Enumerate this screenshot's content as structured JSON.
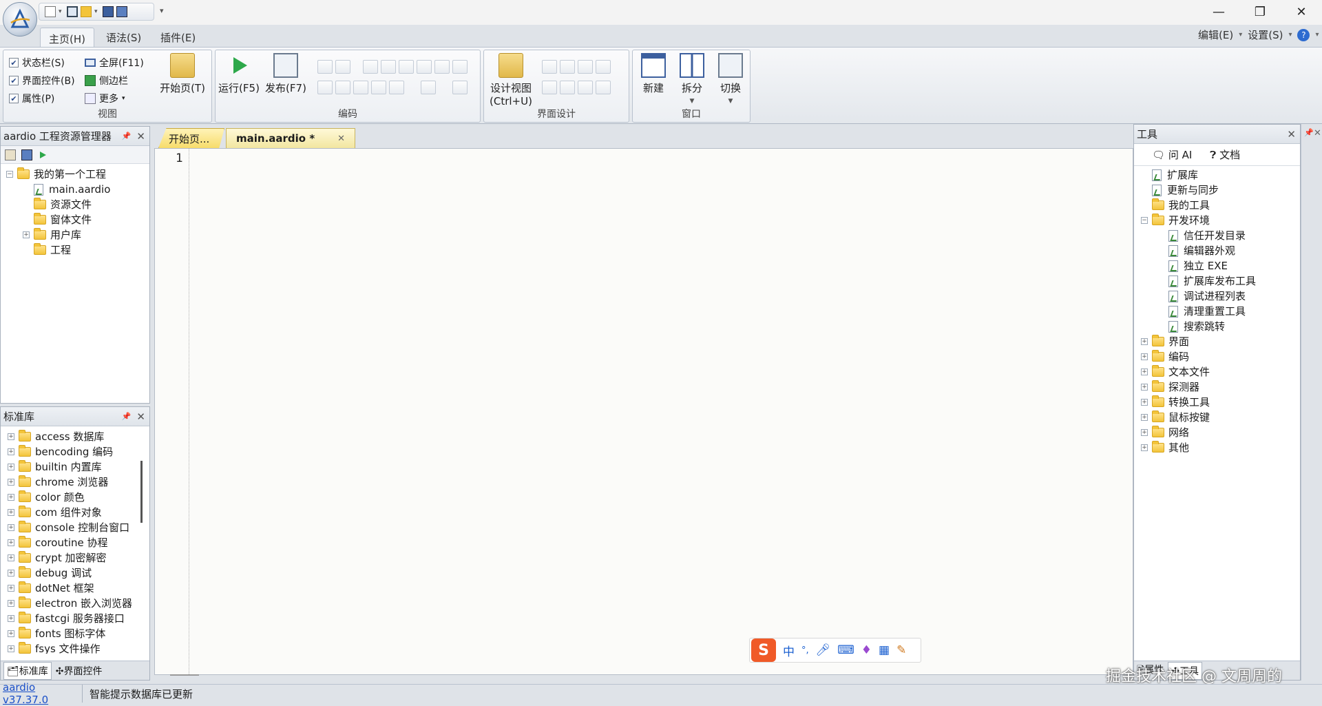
{
  "title_bar": {
    "minimize": "—",
    "restore": "❐",
    "close": "✕",
    "quick_more": "▾"
  },
  "menu_tabs": [
    {
      "label": "主页(H)",
      "active": true
    },
    {
      "label": "语法(S)",
      "active": false
    },
    {
      "label": "插件(E)",
      "active": false
    }
  ],
  "right_menu": {
    "edit": "编辑(E)",
    "settings": "设置(S)",
    "help": "?"
  },
  "ribbon": {
    "view": {
      "label": "视图",
      "status_bar": "状态栏(S)",
      "ui_controls": "界面控件(B)",
      "properties": "属性(P)",
      "fullscreen": "全屏(F11)",
      "sidebar": "侧边栏",
      "more": "更多",
      "start_page": "开始页(T)"
    },
    "coding": {
      "label": "编码",
      "run": "运行(F5)",
      "publish": "发布(F7)"
    },
    "ui_design": {
      "label": "界面设计",
      "design_view_line1": "设计视图",
      "design_view_line2": "(Ctrl+U)"
    },
    "window": {
      "label": "窗口",
      "new": "新建",
      "split": "拆分",
      "switch": "切换"
    }
  },
  "project_panel": {
    "title": "aardio 工程资源管理器",
    "tree": [
      {
        "label": "我的第一个工程",
        "type": "folder",
        "level": 0,
        "expander": "−"
      },
      {
        "label": "main.aardio",
        "type": "file",
        "level": 1
      },
      {
        "label": "资源文件",
        "type": "folder",
        "level": 1
      },
      {
        "label": "窗体文件",
        "type": "folder",
        "level": 1
      },
      {
        "label": "用户库",
        "type": "folder",
        "level": 1,
        "expander": "+"
      },
      {
        "label": "工程",
        "type": "folder",
        "level": 1
      }
    ]
  },
  "stdlib_panel": {
    "title": "标准库",
    "items": [
      "access 数据库",
      "bencoding 编码",
      "builtin 内置库",
      "chrome 浏览器",
      "color 颜色",
      "com 组件对象",
      "console 控制台窗口",
      "coroutine 协程",
      "crypt 加密解密",
      "debug 调试",
      "dotNet 框架",
      "electron 嵌入浏览器",
      "fastcgi 服务器接口",
      "fonts 图标字体",
      "fsys 文件操作"
    ],
    "bottom_tabs": [
      "标准库",
      "界面控件"
    ]
  },
  "editor": {
    "tabs": [
      {
        "label": "开始页..."
      },
      {
        "label": "main.aardio *"
      }
    ],
    "line_number": "1"
  },
  "ime_toolbar": {
    "mode": "中",
    "punct": "°,"
  },
  "tools_panel": {
    "title": "工具",
    "ask_ai": "问 AI",
    "docs": "文档",
    "tree": [
      {
        "label": "扩展库",
        "type": "file",
        "level": 0
      },
      {
        "label": "更新与同步",
        "type": "file",
        "level": 0
      },
      {
        "label": "我的工具",
        "type": "folder",
        "level": 0
      },
      {
        "label": "开发环境",
        "type": "folder",
        "level": 0,
        "expander": "−"
      },
      {
        "label": "信任开发目录",
        "type": "file",
        "level": 1
      },
      {
        "label": "编辑器外观",
        "type": "file",
        "level": 1
      },
      {
        "label": "独立 EXE",
        "type": "file",
        "level": 1
      },
      {
        "label": "扩展库发布工具",
        "type": "file",
        "level": 1
      },
      {
        "label": "调试进程列表",
        "type": "file",
        "level": 1
      },
      {
        "label": "清理重置工具",
        "type": "file",
        "level": 1
      },
      {
        "label": "搜索跳转",
        "type": "file",
        "level": 1
      },
      {
        "label": "界面",
        "type": "folder",
        "level": 0,
        "expander": "+"
      },
      {
        "label": "编码",
        "type": "folder",
        "level": 0,
        "expander": "+"
      },
      {
        "label": "文本文件",
        "type": "folder",
        "level": 0,
        "expander": "+"
      },
      {
        "label": "探测器",
        "type": "folder",
        "level": 0,
        "expander": "+"
      },
      {
        "label": "转换工具",
        "type": "folder",
        "level": 0,
        "expander": "+"
      },
      {
        "label": "鼠标按键",
        "type": "folder",
        "level": 0,
        "expander": "+"
      },
      {
        "label": "网络",
        "type": "folder",
        "level": 0,
        "expander": "+"
      },
      {
        "label": "其他",
        "type": "folder",
        "level": 0,
        "expander": "+"
      }
    ],
    "bottom_tabs": [
      "属性",
      "工具"
    ]
  },
  "status_bar": {
    "version": "aardio v37.37.0",
    "message": "智能提示数据库已更新"
  },
  "watermark": "掘金技术社区 @ 文周周的"
}
